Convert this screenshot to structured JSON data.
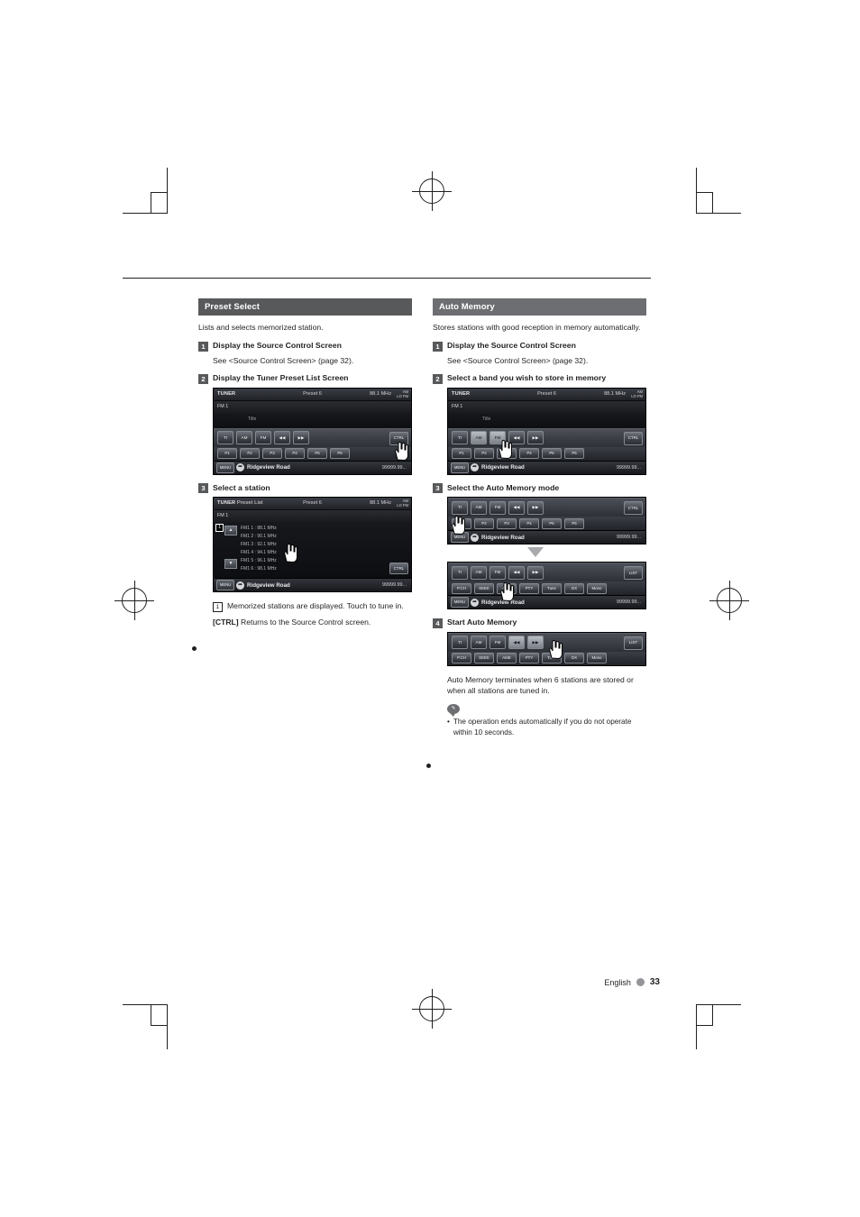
{
  "page": {
    "footer_language": "English",
    "footer_page": "33"
  },
  "left": {
    "section_title": "Preset Select",
    "intro": "Lists and selects memorized station.",
    "steps": [
      {
        "num": "1",
        "title": "Display the Source Control Screen",
        "sub": "See <Source Control Screen> (page 32)."
      },
      {
        "num": "2",
        "title": "Display the Tuner Preset List Screen"
      },
      {
        "num": "3",
        "title": "Select a station"
      }
    ],
    "note_num": "1",
    "note_text": "Memorized stations are displayed. Touch to tune in.",
    "ctrl_key": "[CTRL]",
    "ctrl_text": "Returns to the Source Control screen."
  },
  "right": {
    "section_title": "Auto Memory",
    "intro": "Stores stations with good reception in memory automatically.",
    "steps": [
      {
        "num": "1",
        "title": "Display the Source Control Screen",
        "sub": "See <Source Control Screen> (page 32)."
      },
      {
        "num": "2",
        "title": "Select a band you wish to store in memory"
      },
      {
        "num": "3",
        "title": "Select the Auto Memory mode"
      },
      {
        "num": "4",
        "title": "Start Auto Memory"
      }
    ],
    "caption": "Auto Memory terminates when 6 stations are stored or when all stations are tuned in.",
    "note_icon_label": "✎",
    "note_bullet": "•",
    "note_text": "The operation ends automatically if you do not operate within 10 seconds."
  },
  "screens": {
    "source_control": {
      "header_label": "TUNER",
      "header_mid": "Preset 6",
      "header_right": "88.1 MHz",
      "am_label": "AM",
      "fm_label": "LO FM",
      "band": "FM 1",
      "mid_text": "Title",
      "controls": [
        "TI",
        "AM",
        "FM",
        "◀◀",
        "▶▶"
      ],
      "ctrl_button": "CTRL",
      "presets": [
        "P1",
        "P2",
        "P3",
        "P4",
        "P5",
        "P6"
      ],
      "menu_label": "MENU",
      "station_name": "Ridgeview Road",
      "frequency": "99999.99..."
    },
    "preset_list": {
      "header_label": "TUNER",
      "header_sub": "Preset List",
      "header_mid": "Preset 6",
      "header_right": "88.1 MHz",
      "am_label": "AM",
      "fm_label": "LO FM",
      "band": "FM 1",
      "rows": [
        "FM1 1 : 88.1 MHz",
        "FM1 2 : 90.1 MHz",
        "FM1 3 : 92.1 MHz",
        "FM1 4 : 94.1 MHz",
        "FM1 5 : 96.1 MHz",
        "FM1 6 : 98.1 MHz"
      ],
      "up_arrow": "▲",
      "down_arrow": "▼",
      "sel_num": "1",
      "ctrl_button": "CTRL",
      "menu_label": "MENU",
      "station_name": "Ridgeview Road",
      "frequency": "99999.99..."
    },
    "auto_memory_mode": {
      "controls": [
        "TI",
        "AM",
        "FM",
        "◀◀",
        "▶▶"
      ],
      "ctrl_button": "CTRL",
      "presets": [
        "P1",
        "P2",
        "P3",
        "P4",
        "P5",
        "P6"
      ],
      "menu_label": "MENU",
      "station_name": "Ridgeview Road",
      "frequency": "99999.99..."
    },
    "auto_memory_ctrl": {
      "controls": [
        "TI",
        "AM",
        "FM",
        "◀◀",
        "▶▶"
      ],
      "ctrl_button": "LIST",
      "func_buttons": [
        "P.CH",
        "SEEK",
        "AME",
        "PTY",
        "Tune",
        "DX",
        "Mono"
      ],
      "menu_label": "MENU",
      "station_name": "Ridgeview Road",
      "frequency": "99999.99..."
    },
    "start_auto_memory": {
      "controls": [
        "TI",
        "AM",
        "FM",
        "◀◀",
        "▶▶"
      ],
      "ctrl_button": "LIST",
      "func_buttons": [
        "P.CH",
        "SEEK",
        "AME",
        "PTY",
        "Tune",
        "DX",
        "Mono"
      ]
    }
  }
}
